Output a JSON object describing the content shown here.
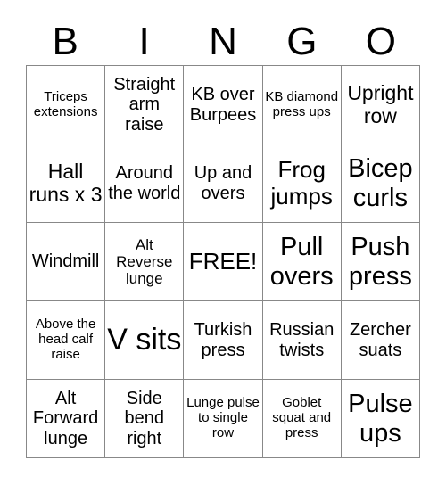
{
  "card": {
    "title_letters": [
      "B",
      "I",
      "N",
      "G",
      "O"
    ],
    "free_space_label": "FREE!",
    "grid": {
      "rows": 5,
      "columns": 5,
      "border_color": "#888888",
      "cell_background": "#ffffff",
      "text_color": "#000000"
    },
    "cells": [
      [
        {
          "text": "Triceps extensions",
          "size": "fs-xs"
        },
        {
          "text": "Straight arm raise",
          "size": "fs-md"
        },
        {
          "text": "KB over Burpees",
          "size": "fs-md"
        },
        {
          "text": "KB diamond press ups",
          "size": "fs-xs"
        },
        {
          "text": "Upright row",
          "size": "fs-lg"
        }
      ],
      [
        {
          "text": "Hall runs x 3",
          "size": "fs-lg"
        },
        {
          "text": "Around the world",
          "size": "fs-md"
        },
        {
          "text": "Up and overs",
          "size": "fs-md"
        },
        {
          "text": "Frog jumps",
          "size": "fs-xl"
        },
        {
          "text": "Bicep curls",
          "size": "fs-xxl"
        }
      ],
      [
        {
          "text": "Windmill",
          "size": "fs-md"
        },
        {
          "text": "Alt Reverse lunge",
          "size": "fs-sm"
        },
        {
          "text": "FREE!",
          "size": "fs-xl"
        },
        {
          "text": "Pull overs",
          "size": "fs-xxl"
        },
        {
          "text": "Push press",
          "size": "fs-xxl"
        }
      ],
      [
        {
          "text": "Above the head calf raise",
          "size": "fs-xs"
        },
        {
          "text": "V sits",
          "size": "fs-huge"
        },
        {
          "text": "Turkish press",
          "size": "fs-md"
        },
        {
          "text": "Russian twists",
          "size": "fs-md"
        },
        {
          "text": "Zercher suats",
          "size": "fs-md"
        }
      ],
      [
        {
          "text": "Alt Forward lunge",
          "size": "fs-md"
        },
        {
          "text": "Side bend right",
          "size": "fs-md"
        },
        {
          "text": "Lunge pulse to single row",
          "size": "fs-xs"
        },
        {
          "text": "Goblet squat and press",
          "size": "fs-xs"
        },
        {
          "text": "Pulse ups",
          "size": "fs-xxl"
        }
      ]
    ]
  }
}
